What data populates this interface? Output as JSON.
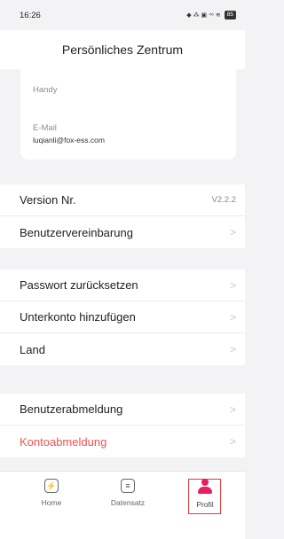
{
  "status_bar": {
    "time": "16:26",
    "icons_text": "◆ ⁂ ▣ ⁴⁶ ≋",
    "battery": "85"
  },
  "header": {
    "title": "Persönliches Zentrum"
  },
  "info_card": {
    "phone_label": "Handy",
    "email_label": "E-Mail",
    "email_value": "luqianli@fox-ess.com"
  },
  "menu": {
    "version_label": "Version Nr.",
    "version_value": "V2.2.2",
    "agreement": "Benutzervereinbarung",
    "reset_password": "Passwort zurücksetzen",
    "add_subaccount": "Unterkonto hinzufügen",
    "country": "Land",
    "logout": "Benutzerabmeldung",
    "delete_account": "Kontoabmeldung",
    "chevron": ">"
  },
  "bottom_nav": {
    "home": "Home",
    "records": "Datensatz",
    "profile": "Profil",
    "home_glyph": "⚡",
    "records_glyph": "≡"
  },
  "colors": {
    "danger": "#ef5350",
    "active_outline": "#e53935",
    "profile_icon": "#e91e63"
  }
}
